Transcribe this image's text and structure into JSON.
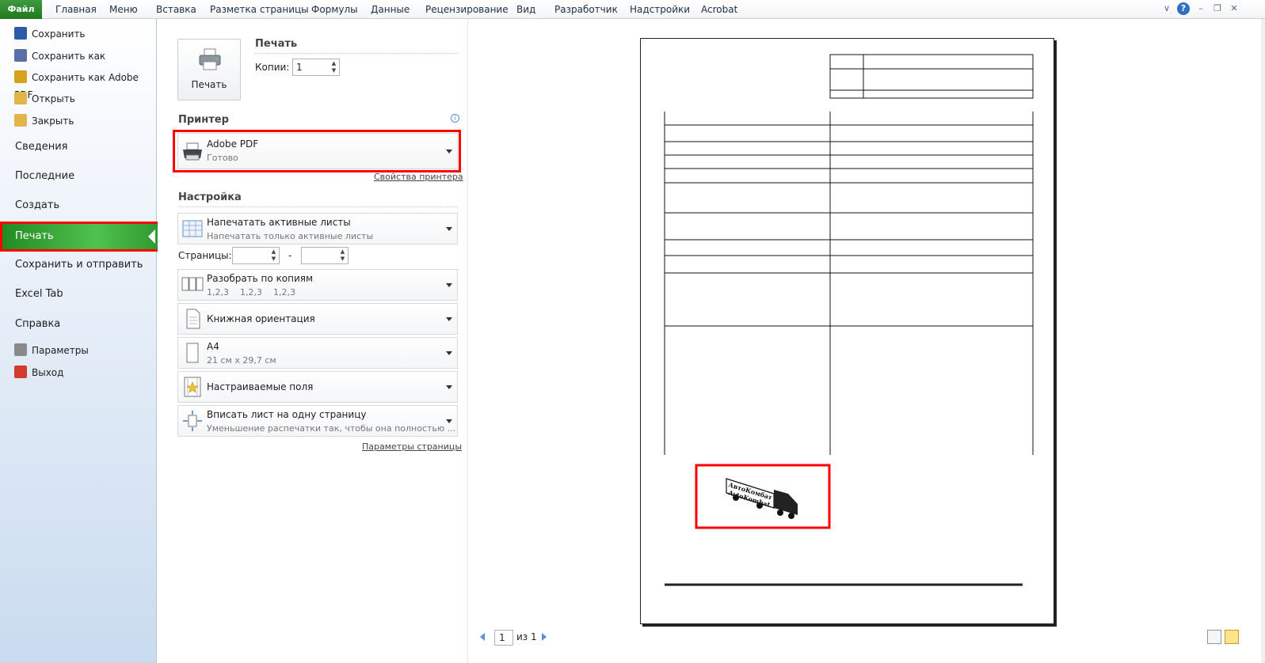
{
  "ribbon": {
    "file_tab": "Файл",
    "tabs": [
      "Главная",
      "Меню",
      "Вставка",
      "Разметка страницы",
      "Формулы",
      "Данные",
      "Рецензирование",
      "Вид",
      "Разработчик",
      "Надстройки",
      "Acrobat"
    ],
    "help_glyph": "?"
  },
  "nav": {
    "small_top": [
      {
        "label": "Сохранить",
        "icon": "save-icon",
        "color": "#2b5aa8"
      },
      {
        "label": "Сохранить как",
        "icon": "save-as-icon",
        "color": "#5a6fa8"
      },
      {
        "label": "Сохранить как Adobe PDF",
        "icon": "pdf-save-icon",
        "color": "#d6a21e"
      },
      {
        "label": "Открыть",
        "icon": "folder-open-icon",
        "color": "#e2b54a"
      },
      {
        "label": "Закрыть",
        "icon": "folder-close-icon",
        "color": "#e2b54a"
      }
    ],
    "big": [
      "Сведения",
      "Последние",
      "Создать"
    ],
    "active": "Печать",
    "big_after": [
      "Сохранить и отправить",
      "Excel Tab",
      "Справка"
    ],
    "small_bottom": [
      {
        "label": "Параметры",
        "icon": "options-icon",
        "color": "#8a8a8a"
      },
      {
        "label": "Выход",
        "icon": "exit-icon",
        "color": "#d23a2a"
      }
    ],
    "accent": "#2f9a2f"
  },
  "print": {
    "section_title": "Печать",
    "button_label": "Печать",
    "copies_label": "Копии:",
    "copies_value": "1"
  },
  "printer": {
    "section_title": "Принтер",
    "name": "Adobe PDF",
    "status": "Готово",
    "properties_link": "Свойства принтера"
  },
  "settings": {
    "section_title": "Настройка",
    "sheets": {
      "title": "Напечатать активные листы",
      "sub": "Напечатать только активные листы"
    },
    "pages_label": "Страницы:",
    "pages_from": "",
    "pages_to": "",
    "pages_dash": "-",
    "collate": {
      "title": "Разобрать по копиям",
      "sub": "1,2,3    1,2,3    1,2,3"
    },
    "orientation": {
      "title": "Книжная ориентация"
    },
    "paper": {
      "title": "A4",
      "sub": "21 см x 29,7 см"
    },
    "margins": {
      "title": "Настраиваемые поля"
    },
    "scaling": {
      "title": "Вписать лист на одну страницу",
      "sub": "Уменьшение распечатки так, чтобы она полностью ..."
    },
    "page_setup_link": "Параметры страницы"
  },
  "preview": {
    "page_number": "1",
    "page_total": "из 1",
    "logo_text_1": "АвтоКомбат",
    "logo_text_2": "AvtoKombat"
  }
}
